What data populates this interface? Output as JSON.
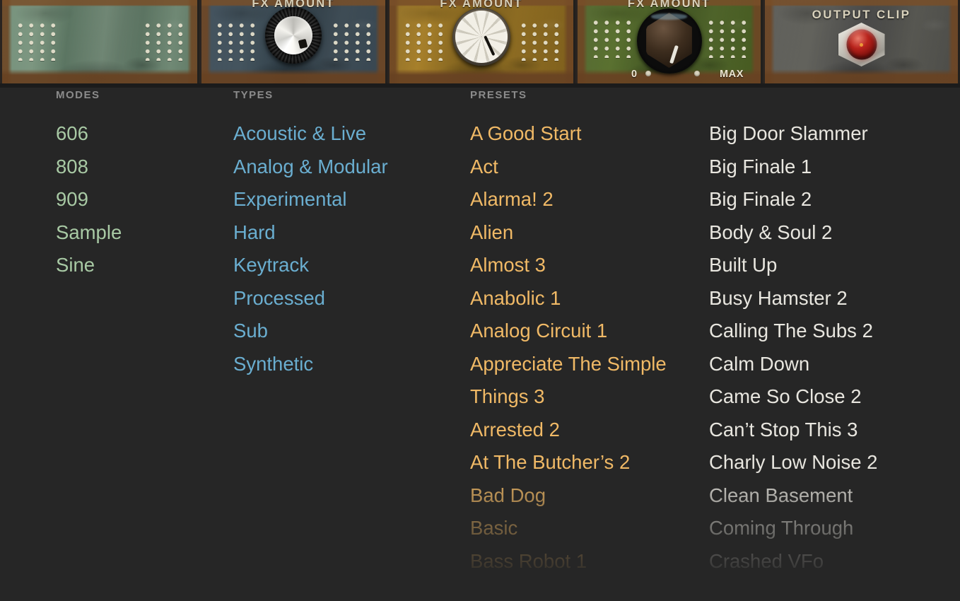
{
  "fx_rack": {
    "modules": [
      {
        "name": "module-1-green",
        "label": "",
        "knob": "none",
        "plate_color": "#6e8a74"
      },
      {
        "name": "module-2-blue",
        "label": "FX AMOUNT",
        "knob": "metal",
        "plate_color": "#3c4c58"
      },
      {
        "name": "module-3-gold",
        "label": "FX AMOUNT",
        "knob": "fluted",
        "plate_color": "#9a7524"
      },
      {
        "name": "module-4-olive",
        "label": "FX AMOUNT",
        "knob": "dark",
        "plate_color": "#53682c",
        "scale_min": "0",
        "scale_max": "MAX"
      },
      {
        "name": "module-5-gray",
        "label": "OUTPUT CLIP",
        "knob": "led",
        "plate_color": "#5a5a55"
      }
    ]
  },
  "browser": {
    "columns": [
      {
        "id": "modes",
        "header": "MODES",
        "color": "#a8c9a4",
        "items": [
          "606",
          "808",
          "909",
          "Sample",
          "Sine"
        ]
      },
      {
        "id": "types",
        "header": "TYPES",
        "color": "#6aaed0",
        "items": [
          "Acoustic & Live",
          "Analog & Modular",
          "Experimental",
          "Hard",
          "Keytrack",
          "Processed",
          "Sub",
          "Synthetic"
        ]
      },
      {
        "id": "presets",
        "header": "PRESETS",
        "color": "#f0b966",
        "items": [
          "A Good Start",
          "Act",
          "Alarma! 2",
          "Alien",
          "Almost 3",
          "Anabolic 1",
          "Analog Circuit 1",
          "Appreciate The Simple",
          "Things 3",
          "Arrested 2",
          "At The Butcher’s 2",
          "Bad Dog",
          "Basic",
          "Bass Robot 1"
        ]
      },
      {
        "id": "presets2",
        "header": "",
        "color": "#e8e6df",
        "items": [
          "Big Door Slammer",
          "Big Finale 1",
          "Big Finale 2",
          "Body & Soul 2",
          "Built Up",
          "Busy Hamster 2",
          "Calling The Subs 2",
          "Calm Down",
          "Came So Close 2",
          "Can’t Stop This 3",
          "Charly Low Noise 2",
          "Clean Basement",
          "Coming Through",
          "Crashed VFo"
        ]
      }
    ]
  },
  "colors": {
    "background": "#262626",
    "header_text": "#8b8b8b",
    "modes": "#a8c9a4",
    "types": "#6aaed0",
    "presets": "#f0b966",
    "presets_alt": "#e8e6df",
    "led": "#b8231c"
  }
}
